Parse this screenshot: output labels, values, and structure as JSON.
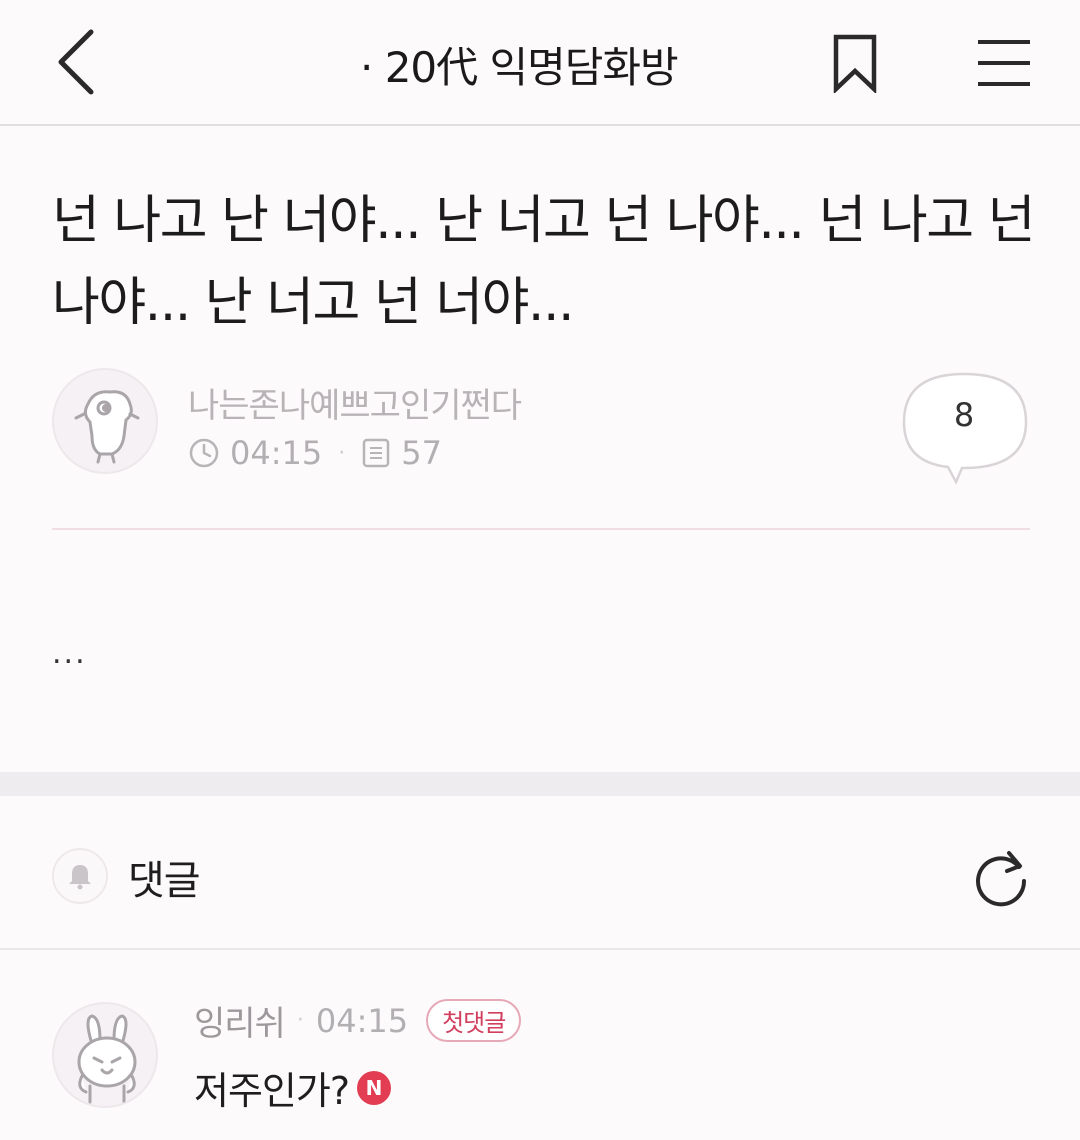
{
  "header": {
    "title": "· 20代 익명담화방",
    "back_icon": "chevron-left-icon",
    "bookmark_icon": "bookmark-icon",
    "menu_icon": "hamburger-menu-icon"
  },
  "post": {
    "title": "넌 나고 난 너야... 난 너고 넌 나야... 넌 나고 넌 나야... 난 너고 넌 너야...",
    "author": "나는존나예쁘고인기쩐다",
    "time": "04:15",
    "views": "57",
    "comment_count": "8",
    "body": "..."
  },
  "comments_section": {
    "label": "댓글",
    "bell_icon": "bell-icon",
    "refresh_icon": "refresh-icon"
  },
  "comments": [
    {
      "author": "잉리쉬",
      "time": "04:15",
      "badge": "첫댓글",
      "text": "저주인가?",
      "new_badge": "N"
    }
  ],
  "colors": {
    "background": "#fdfafc",
    "accent": "#e23d52",
    "muted_text": "#b2afb2",
    "divider": "#e1dee1"
  }
}
